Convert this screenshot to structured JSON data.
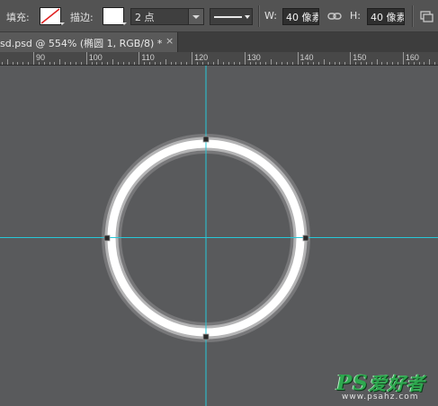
{
  "options_bar": {
    "fill_label": "填充:",
    "stroke_label": "描边:",
    "stroke_width": "2 点",
    "width_label": "W:",
    "width_value": "40 像素",
    "height_label": "H:",
    "height_value": "40 像素"
  },
  "document_tab": {
    "title": "sd.psd @ 554% (椭圆 1, RGB/8) *",
    "close_glyph": "×"
  },
  "ruler": {
    "labels": [
      "90",
      "100",
      "110",
      "120",
      "130",
      "140",
      "150",
      "160"
    ]
  },
  "colors": {
    "guide": "#27c8d8",
    "canvas": "#595a5c",
    "ellipse_stroke": "#ffffff",
    "watermark": "#2ea84f"
  },
  "icons": {
    "link": "chain-link-icon",
    "options_right": "panel-icon"
  },
  "watermark": {
    "brand": "PS",
    "tagline": "爱好者",
    "url": "www.psahz.com"
  }
}
